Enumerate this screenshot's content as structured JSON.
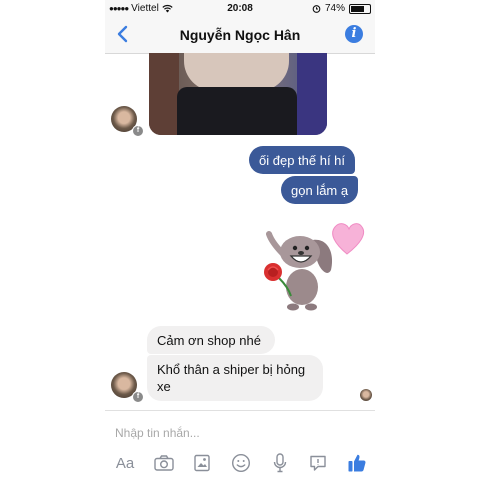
{
  "status_bar": {
    "signal": "●●●●●",
    "carrier": "Viettel",
    "time": "20:08",
    "battery_percent": "74%",
    "battery_level": 0.74
  },
  "header": {
    "title": "Nguyễn Ngọc Hân",
    "back_icon": "chevron-left-icon",
    "info_icon": "info-icon",
    "info_glyph": "i"
  },
  "messages": {
    "sent": [
      "ối đẹp thế hí hí",
      "gọn lắm ạ"
    ],
    "received": [
      "Cảm ơn shop nhé",
      "Khổ thân a shiper bị hỏng xe"
    ]
  },
  "composer": {
    "placeholder": "Nhập tin nhắn...",
    "text_format_label": "Aa"
  },
  "colors": {
    "accent": "#3b7de0",
    "sent_bubble": "#3b5998",
    "received_bubble": "#f1f0f0"
  }
}
